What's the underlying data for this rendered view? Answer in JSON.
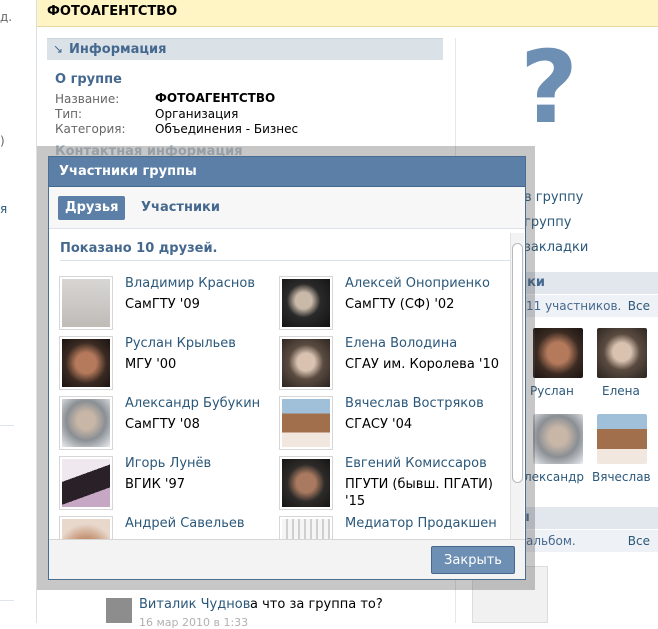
{
  "left_fragments": [
    "д.",
    ")",
    "я"
  ],
  "header": {
    "title": "ФОТОАГЕНТСТВО"
  },
  "info": {
    "section_title": "Информация",
    "about_title": "О группе",
    "props": [
      {
        "label": "Название:",
        "value": "ФОТОАГЕНТСТВО"
      },
      {
        "label": "Тип:",
        "value": "Организация"
      },
      {
        "label": "Категория:",
        "value": "Объединения - Бизнес"
      }
    ],
    "contacts_peek": "Контактная информация"
  },
  "side": {
    "question_mark": "?",
    "links": [
      "в группу",
      "группу",
      "закладки"
    ],
    "members_title": "ики",
    "members_count": "11 участников.",
    "members_all": "Все",
    "members": [
      {
        "name": "Руслан",
        "photo": "g-face"
      },
      {
        "name": "Елена",
        "photo": "g-girl"
      },
      {
        "name": "лександр",
        "photo": "g-beard"
      },
      {
        "name": "Вячеслав",
        "photo": "g-crowd"
      }
    ],
    "albums_title": "ы",
    "albums_count": "альбом.",
    "albums_all": "Все"
  },
  "wall": {
    "author": "Виталик Чуднов",
    "text": "а что за группа то?",
    "date": "16 мар 2010 в 1:33"
  },
  "modal": {
    "title": "Участники группы",
    "tab_friends": "Друзья",
    "tab_members": "Участники",
    "shown": "Показано 10 друзей.",
    "close": "Закрыть",
    "friends": [
      {
        "name": "Владимир Краснов",
        "uni": "СамГТУ '09",
        "photo": "g-light"
      },
      {
        "name": "Алексей Оноприенко",
        "uni": "СамГТУ (СФ) '02",
        "photo": "g-dark"
      },
      {
        "name": "Руслан Крыльев",
        "uni": "МГУ '00",
        "photo": "g-face"
      },
      {
        "name": "Елена Володина",
        "uni": "СГАУ им. Королева '10",
        "photo": "g-girl"
      },
      {
        "name": "Александр Бубукин",
        "uni": "СамГТУ '08",
        "photo": "g-beard"
      },
      {
        "name": "Вячеслав Востряков",
        "uni": "СГАСУ '04",
        "photo": "g-crowd"
      },
      {
        "name": "Игорь Лунёв",
        "uni": "ВГИК '97",
        "photo": "g-bw"
      },
      {
        "name": "Евгений Комиссаров",
        "uni": "ПГУТИ (бывш. ПГАТИ) '15",
        "photo": "g-man"
      },
      {
        "name": "Андрей Савельев",
        "uni": "",
        "photo": "g-sav"
      },
      {
        "name": "Медиатор Продакшен",
        "uni": "",
        "photo": "g-med"
      }
    ]
  }
}
